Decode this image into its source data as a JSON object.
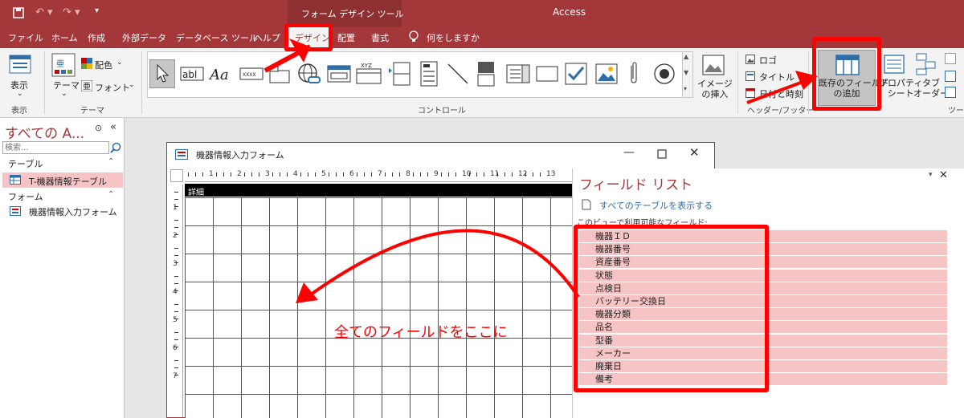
{
  "titlebar": {
    "context_tool": "フォーム デザイン ツール",
    "app_title": "Access"
  },
  "tabs": [
    "ファイル",
    "ホーム",
    "作成",
    "外部データ",
    "データベース ツール",
    "ヘルプ",
    "デザイン",
    "配置",
    "書式"
  ],
  "tell_me": "何をしますか",
  "ribbon": {
    "view_label": "表示",
    "view_group": "表示",
    "theme_label": "テーマ",
    "color_label": "配色",
    "font_label": "フォント",
    "theme_group": "テーマ",
    "controls_group": "コントロール",
    "image_insert_label": "イメージ\nの挿入",
    "logo_label": "ロゴ",
    "title_label": "タイトル",
    "datetime_label": "日付と時刻",
    "header_footer_group": "ヘッダー/フッター",
    "add_fields_label": "既存のフィールド\nの追加",
    "property_label": "プロパティ\nシート",
    "tab_order_label": "タブ\nオーダー",
    "tools_group": "ツー"
  },
  "nav": {
    "title": "すべての A...",
    "search_placeholder": "検索...",
    "sections": [
      {
        "title": "テーブル",
        "items": [
          "T-機器情報テーブル"
        ]
      },
      {
        "title": "フォーム",
        "items": [
          "機器情報入力フォーム"
        ]
      }
    ]
  },
  "form_window": {
    "title": "機器情報入力フォーム",
    "section": "詳細",
    "ruler_nums": [
      "1",
      "2",
      "3",
      "4",
      "5",
      "6",
      "7",
      "8",
      "9",
      "10",
      "11",
      "12",
      "13"
    ],
    "vruler_nums": [
      "1",
      "2",
      "3",
      "4",
      "5",
      "6",
      "7"
    ]
  },
  "field_list": {
    "title": "フィールド リスト",
    "show_all": "すべてのテーブルを表示する",
    "available_label": "このビューで利用可能なフィールド:",
    "fields": [
      "機器ＩＤ",
      "機器番号",
      "資産番号",
      "状態",
      "点検日",
      "バッテリー交換日",
      "機器分類",
      "品名",
      "型番",
      "メーカー",
      "廃棄日",
      "備考"
    ]
  },
  "annotation": {
    "text": "全てのフィールドをここに"
  },
  "colors": {
    "accent": "#a4373a",
    "highlight": "#ff0000",
    "field_bg": "#f7c4c6"
  }
}
